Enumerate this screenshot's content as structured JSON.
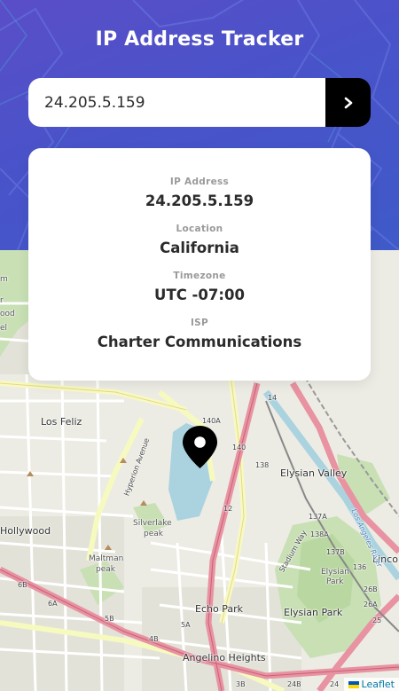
{
  "header": {
    "title": "IP Address Tracker"
  },
  "search": {
    "value": "24.205.5.159",
    "submit_icon": "chevron-right-icon"
  },
  "info": {
    "ip_label": "IP Address",
    "ip_value": "24.205.5.159",
    "location_label": "Location",
    "location_value": "California",
    "timezone_label": "Timezone",
    "timezone_value": "UTC -07:00",
    "isp_label": "ISP",
    "isp_value": "Charter Communications"
  },
  "map": {
    "marker_icon": "location-pin-icon",
    "places": {
      "los_feliz": "Los Feliz",
      "hollywood": "Hollywood",
      "silverlake": "Silverlake",
      "peak": "peak",
      "maltman": "Maltman",
      "elysian_valley": "Elysian Valley",
      "elysian": "Elysian",
      "park_word": "Park",
      "echo_park": "Echo Park",
      "elysian_park": "Elysian Park",
      "angelino_heights": "Angelino Heights",
      "linco": "Linco",
      "stadium_way": "Stadium Way",
      "la_river": "Los Angeles River",
      "hyperion": "Hyperion Avenue",
      "edge_m": "m",
      "edge_r": "r",
      "edge_ood": "ood",
      "edge_el": "el"
    },
    "exits": {
      "e14": "14",
      "e140a": "140A",
      "e140": "140",
      "e138": "138",
      "e12": "12",
      "e138a": "138A",
      "e137a": "137A",
      "e137b": "137B",
      "e136": "136",
      "e26b": "26B",
      "e26a": "26A",
      "e25": "25",
      "e6b": "6B",
      "e6a": "6A",
      "e5b": "5B",
      "e4b": "4B",
      "e5a": "5A",
      "e3b": "3B",
      "e24b": "24B",
      "e24": "24"
    }
  },
  "attribution": {
    "label": "Leaflet"
  },
  "colors": {
    "hero_start": "#5a4ec8",
    "hero_end": "#3f5ac9",
    "button": "#000000",
    "label_gray": "#9a9a9a",
    "value_dark": "#2b2b2b",
    "freeway": "#e892a2",
    "major_road": "#f7fabf",
    "park": "#c8e0b4",
    "water": "#aad3df"
  }
}
